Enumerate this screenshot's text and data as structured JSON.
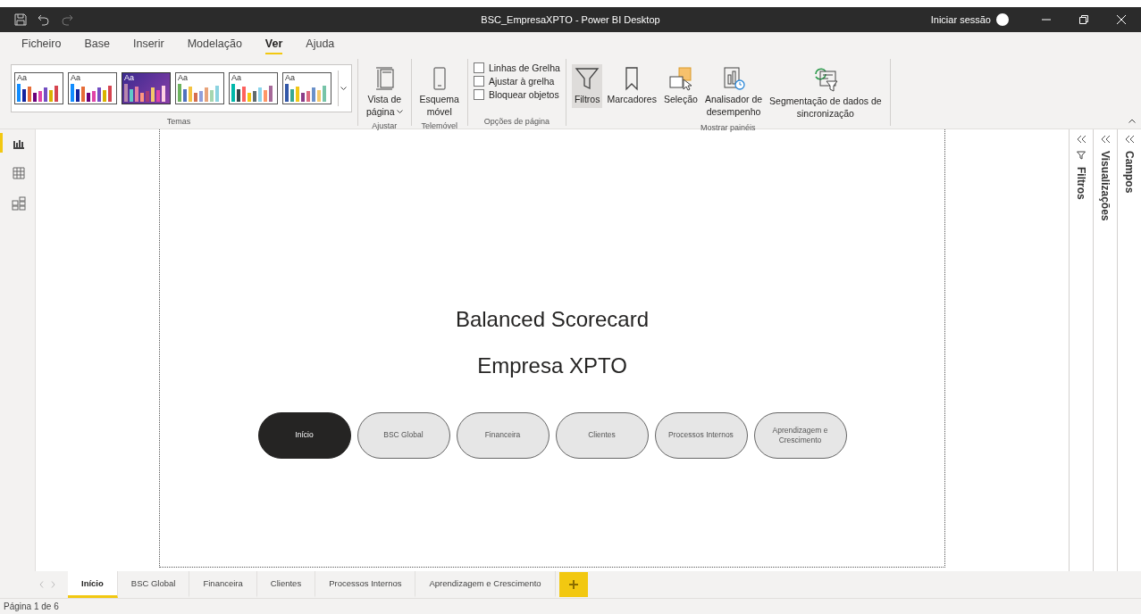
{
  "window": {
    "title": "BSC_EmpresaXPTO - Power BI Desktop",
    "sign_in": "Iniciar sessão"
  },
  "menu": [
    {
      "label": "Ficheiro",
      "selected": false
    },
    {
      "label": "Base",
      "selected": false
    },
    {
      "label": "Inserir",
      "selected": false
    },
    {
      "label": "Modelação",
      "selected": false
    },
    {
      "label": "Ver",
      "selected": true
    },
    {
      "label": "Ajuda",
      "selected": false
    }
  ],
  "ribbon": {
    "themes": {
      "label": "Temas",
      "items": [
        {
          "text": "Aa",
          "selected": false
        },
        {
          "text": "Aa",
          "selected": false
        },
        {
          "text": "Aa",
          "selected": true
        },
        {
          "text": "Aa",
          "selected": false
        },
        {
          "text": "Aa",
          "selected": false
        },
        {
          "text": "Aa",
          "selected": false
        }
      ]
    },
    "fit": {
      "label": "Ajustar",
      "button": [
        "Vista de",
        "página"
      ]
    },
    "mobile": {
      "label": "Telemóvel",
      "button": [
        "Esquema",
        "móvel"
      ]
    },
    "page_options": {
      "label": "Opções de página",
      "checkboxes": [
        {
          "label": "Linhas de Grelha",
          "checked": false
        },
        {
          "label": "Ajustar à grelha",
          "checked": false
        },
        {
          "label": "Bloquear objetos",
          "checked": false
        }
      ]
    },
    "panes": {
      "label": "Mostrar painéis",
      "buttons": [
        {
          "kind": "filter",
          "lines": [
            "Filtros"
          ],
          "selected": true
        },
        {
          "kind": "bookmark",
          "lines": [
            "Marcadores"
          ],
          "selected": false
        },
        {
          "kind": "selection",
          "lines": [
            "Seleção"
          ],
          "selected": false
        },
        {
          "kind": "analyzer",
          "lines": [
            "Analisador de",
            "desempenho"
          ],
          "selected": false
        },
        {
          "kind": "sync",
          "lines": [
            "Segmentação de dados de",
            "sincronização"
          ],
          "selected": false
        }
      ]
    }
  },
  "left_nav": [
    {
      "kind": "report",
      "selected": true
    },
    {
      "kind": "table",
      "selected": false
    },
    {
      "kind": "model",
      "selected": false
    }
  ],
  "canvas": {
    "title": "Balanced Scorecard",
    "subtitle": "Empresa XPTO",
    "nav_buttons": [
      {
        "lines": [
          "Início"
        ],
        "selected": true
      },
      {
        "lines": [
          "BSC Global"
        ],
        "selected": false
      },
      {
        "lines": [
          "Financeira"
        ],
        "selected": false
      },
      {
        "lines": [
          "Clientes"
        ],
        "selected": false
      },
      {
        "lines": [
          "Processos Internos"
        ],
        "selected": false
      },
      {
        "lines": [
          "Aprendizagem e",
          "Crescimento"
        ],
        "selected": false
      }
    ]
  },
  "side_panes": [
    {
      "kind": "filters",
      "label": "Filtros"
    },
    {
      "kind": "plain",
      "label": "Visualizações"
    },
    {
      "kind": "plain",
      "label": "Campos"
    }
  ],
  "page_tabs": [
    {
      "label": "Início",
      "selected": true
    },
    {
      "label": "BSC Global",
      "selected": false
    },
    {
      "label": "Financeira",
      "selected": false
    },
    {
      "label": "Clientes",
      "selected": false
    },
    {
      "label": "Processos Internos",
      "selected": false
    },
    {
      "label": "Aprendizagem e Crescimento",
      "selected": false
    }
  ],
  "status_bar": "Página 1 de 6"
}
